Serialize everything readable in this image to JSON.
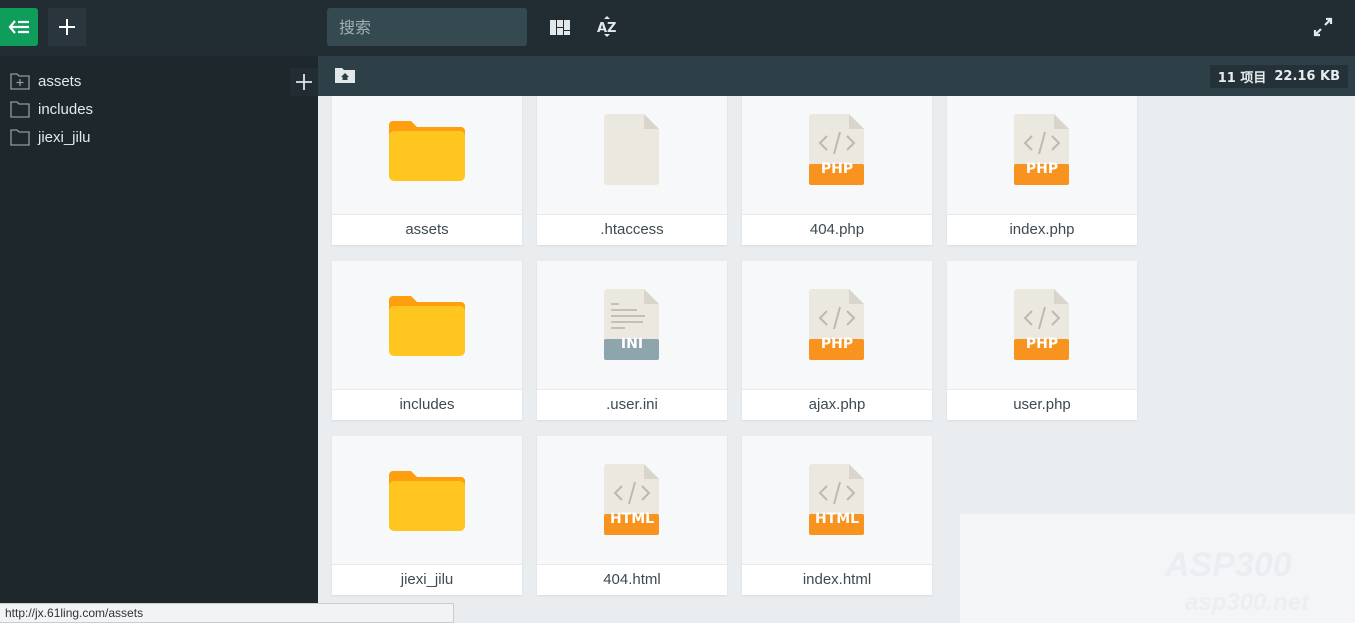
{
  "header": {
    "search_placeholder": "搜索"
  },
  "sidebar": {
    "items": [
      {
        "label": "assets",
        "icon": "folder-plus-icon"
      },
      {
        "label": "includes",
        "icon": "folder-icon"
      },
      {
        "label": "jiexi_jilu",
        "icon": "folder-icon"
      }
    ]
  },
  "toolbar": {
    "count": "11 项目",
    "size": "22.16 KB"
  },
  "files": [
    {
      "name": "assets",
      "type": "folder"
    },
    {
      "name": ".htaccess",
      "type": "blank"
    },
    {
      "name": "404.php",
      "type": "code",
      "badge": "PHP"
    },
    {
      "name": "index.php",
      "type": "code",
      "badge": "PHP"
    },
    {
      "name": "includes",
      "type": "folder"
    },
    {
      "name": ".user.ini",
      "type": "text",
      "badge": "INI"
    },
    {
      "name": "ajax.php",
      "type": "code",
      "badge": "PHP"
    },
    {
      "name": "user.php",
      "type": "code",
      "badge": "PHP"
    },
    {
      "name": "jiexi_jilu",
      "type": "folder"
    },
    {
      "name": "404.html",
      "type": "code",
      "badge": "HTML"
    },
    {
      "name": "index.html",
      "type": "code",
      "badge": "HTML"
    }
  ],
  "status_url": "http://jx.61ling.com/assets",
  "watermark": {
    "line1": "ASP300",
    "line2": "asp300.net"
  },
  "colors": {
    "accent": "#0f9d58",
    "php": "#f7931e",
    "ini": "#8fa5ae",
    "folder": "#ffc61f"
  }
}
